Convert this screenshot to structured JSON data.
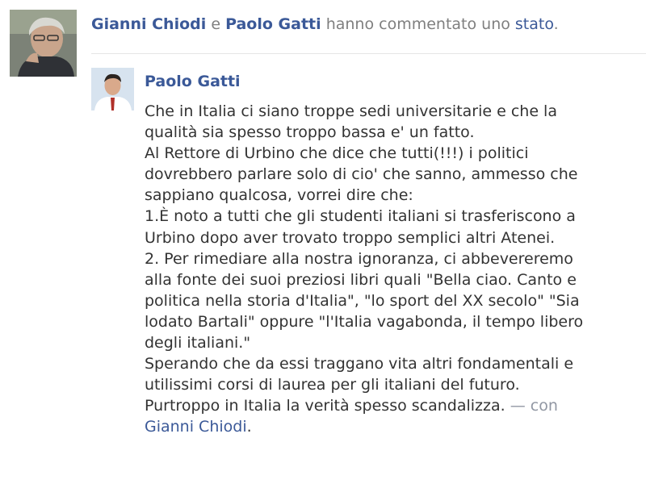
{
  "story": {
    "actor1": "Gianni Chiodi",
    "conjunction": "e",
    "actor2": "Paolo Gatti",
    "action": "hanno commentato uno",
    "object_link": "stato",
    "end_punct": "."
  },
  "post": {
    "author": "Paolo Gatti",
    "lines": [
      "Che in Italia ci siano troppe sedi universitarie e che la",
      "qualità sia spesso troppo bassa e' un fatto.",
      "Al Rettore di Urbino che dice che tutti(!!!) i politici",
      "dovrebbero parlare solo di cio' che sanno, ammesso che",
      "sappiano qualcosa, vorrei dire che:",
      "1.È noto a tutti che gli studenti italiani si trasferiscono a",
      "Urbino dopo aver trovato troppo semplici altri Atenei.",
      "2. Per rimediare alla nostra ignoranza, ci abbevereremo",
      "alla fonte dei suoi preziosi libri quali \"Bella ciao. Canto e",
      "politica nella storia d'Italia\", \"lo sport del XX secolo\" \"Sia",
      "lodato Bartali\" oppure \"l'Italia vagabonda, il tempo libero",
      "degli italiani.\"",
      "Sperando che da essi traggano vita altri fondamentali e",
      "utilissimi corsi di laurea per gli italiani del futuro.",
      "Purtroppo in Italia la verità spesso scandalizza."
    ],
    "with_separator": " — con",
    "tagged_user": "Gianni Chiodi",
    "tagged_end": "."
  },
  "colors": {
    "link": "#3b5998",
    "meta": "#7f7f7f",
    "body": "#333333",
    "muted": "#9197a3"
  },
  "icons": {
    "actor_photo": "profile-photo",
    "author_photo": "profile-photo"
  }
}
